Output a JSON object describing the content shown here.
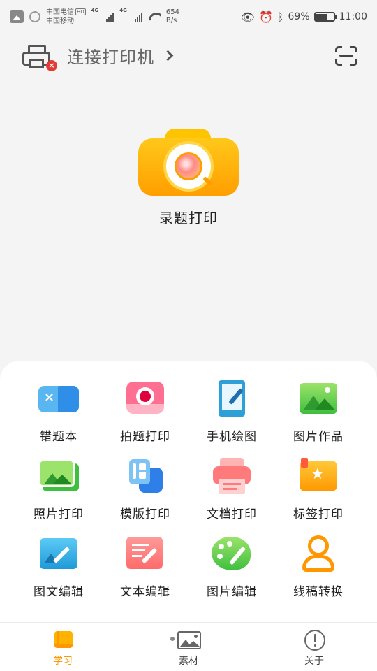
{
  "status_bar": {
    "carrier1": "中国电信",
    "carrier1_badge": "HD",
    "carrier2": "中国移动",
    "net1": "4G",
    "net2": "4G",
    "speed_value": "654",
    "speed_unit": "B/s",
    "battery": "69%",
    "battery_level": 0.69,
    "time": "11:00"
  },
  "header": {
    "connect_label": "连接打印机",
    "printer_status": "disconnected"
  },
  "hero": {
    "label": "录题打印"
  },
  "features": [
    {
      "label": "错题本",
      "icon": "error-book-icon"
    },
    {
      "label": "拍题打印",
      "icon": "photo-question-print-icon"
    },
    {
      "label": "手机绘图",
      "icon": "tablet-drawing-icon"
    },
    {
      "label": "图片作品",
      "icon": "picture-works-icon"
    },
    {
      "label": "照片打印",
      "icon": "photo-print-icon"
    },
    {
      "label": "模版打印",
      "icon": "template-print-icon"
    },
    {
      "label": "文档打印",
      "icon": "document-print-icon"
    },
    {
      "label": "标签打印",
      "icon": "label-print-icon"
    },
    {
      "label": "图文编辑",
      "icon": "image-text-edit-icon"
    },
    {
      "label": "文本编辑",
      "icon": "text-edit-icon"
    },
    {
      "label": "图片编辑",
      "icon": "palette-icon"
    },
    {
      "label": "线稿转换",
      "icon": "line-art-convert-icon"
    }
  ],
  "tabs": [
    {
      "label": "学习",
      "icon": "book-icon",
      "active": true
    },
    {
      "label": "素材",
      "icon": "image-icon",
      "active": false
    },
    {
      "label": "关于",
      "icon": "info-icon",
      "active": false
    }
  ],
  "colors": {
    "accent": "#ff9800",
    "background": "#f4f4f4",
    "panel": "#ffffff"
  }
}
